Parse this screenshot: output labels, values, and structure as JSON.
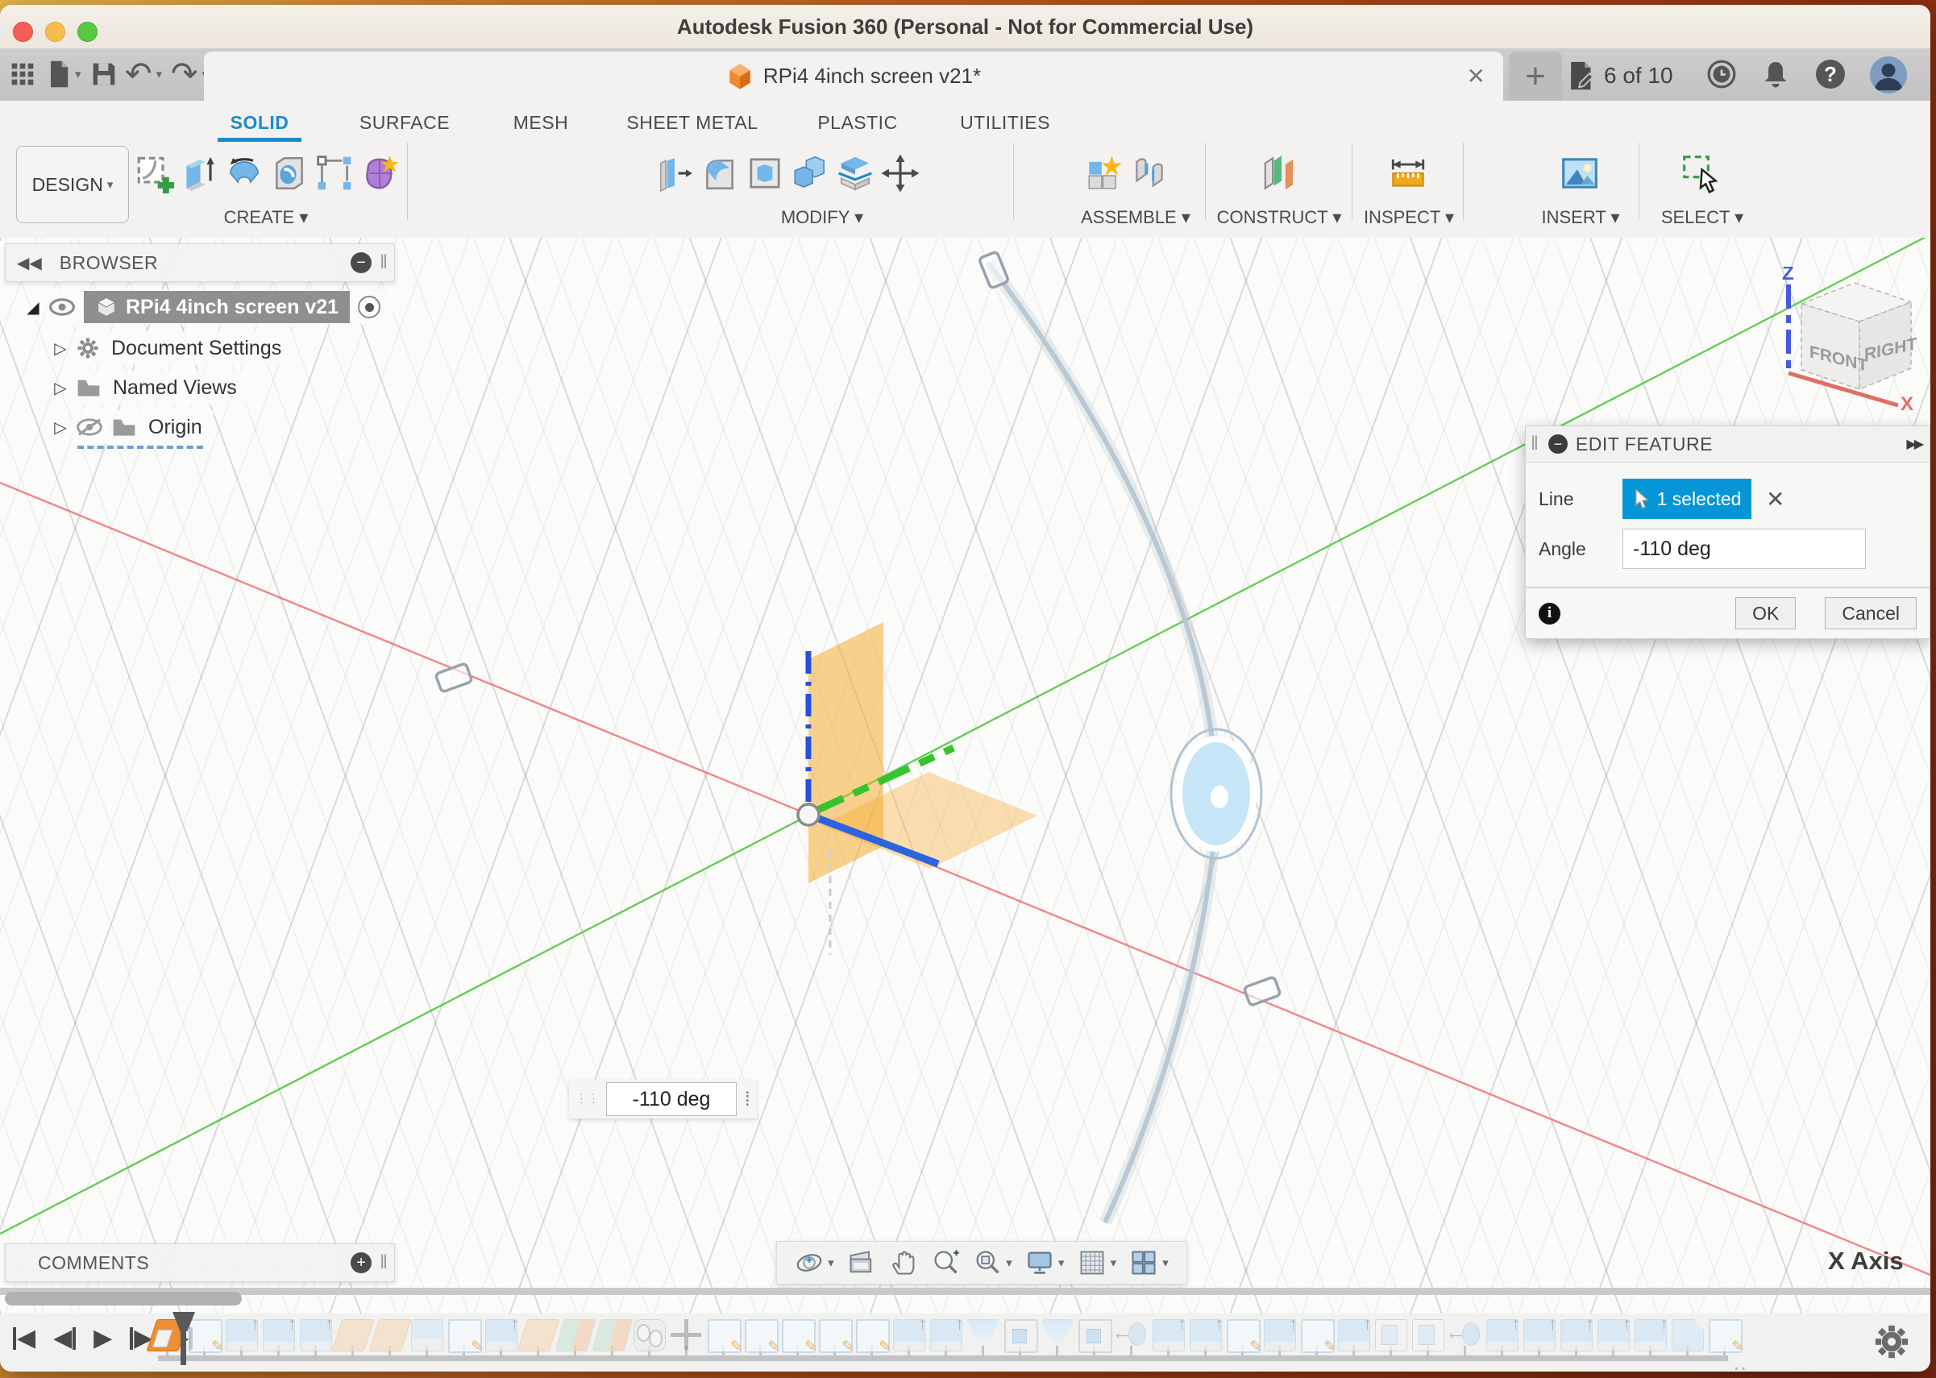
{
  "window": {
    "title": "Autodesk Fusion 360 (Personal - Not for Commercial Use)"
  },
  "toolbar": {
    "document_tab": "RPi4 4inch screen v21*",
    "job_status": "6 of 10"
  },
  "ribbon": {
    "mode_label": "DESIGN",
    "tabs": [
      "SOLID",
      "SURFACE",
      "MESH",
      "SHEET METAL",
      "PLASTIC",
      "UTILITIES"
    ],
    "active_tab": "SOLID",
    "groups": {
      "create": "CREATE",
      "modify": "MODIFY",
      "assemble": "ASSEMBLE",
      "construct": "CONSTRUCT",
      "inspect": "INSPECT",
      "insert": "INSERT",
      "select": "SELECT"
    }
  },
  "browser": {
    "title": "BROWSER",
    "root_label": "RPi4 4inch screen v21",
    "items": [
      "Document Settings",
      "Named Views",
      "Origin"
    ]
  },
  "dialog": {
    "title": "EDIT FEATURE",
    "line_label": "Line",
    "line_value": "1 selected",
    "angle_label": "Angle",
    "angle_value": "-110 deg",
    "ok_label": "OK",
    "cancel_label": "Cancel"
  },
  "canvas": {
    "angle_value": "-110 deg",
    "x_axis_label": "X Axis",
    "viewcube": {
      "front": "FRONT",
      "right": "RIGHT",
      "z_label": "Z",
      "x_label": "X"
    }
  },
  "comments": {
    "title": "COMMENTS"
  },
  "timeline": {
    "features": [
      "plane-active",
      "sketch",
      "extrude",
      "extrude",
      "extrude",
      "plane",
      "plane",
      "box",
      "sketch",
      "extrude",
      "plane",
      "planes",
      "planes",
      "cylinders",
      "move",
      "sketch",
      "sketch",
      "sketch",
      "sketch",
      "sketch",
      "extrude",
      "extrude",
      "loft",
      "shell",
      "loft",
      "shell",
      "mirror",
      "extrude",
      "extrude",
      "sketch",
      "extrude",
      "sketch",
      "extrude",
      "boxes",
      "boxes",
      "mirror",
      "extrude",
      "extrude",
      "extrude",
      "extrude",
      "extrude",
      "chamfer",
      "sketch"
    ]
  },
  "colors": {
    "accent_blue": "#0696d7",
    "tab_blue": "#1a8cc7",
    "plane_orange": "#f5a623",
    "axis_red": "#e05252",
    "axis_green": "#3fca3f",
    "axis_blue": "#2b63e0"
  }
}
